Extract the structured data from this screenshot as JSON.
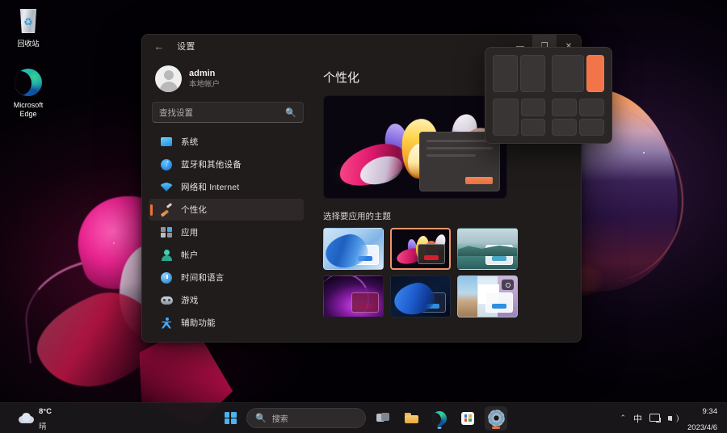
{
  "desktop": {
    "icons": [
      {
        "name": "recycle-bin",
        "label": "回收站"
      },
      {
        "name": "microsoft-edge",
        "label": "Microsoft\nEdge"
      }
    ]
  },
  "window": {
    "title": "设置",
    "back_label": "←",
    "caption": {
      "minimize": "—",
      "maximize": "❐",
      "close": "✕"
    },
    "account": {
      "name": "admin",
      "type": "本地帐户"
    },
    "search": {
      "placeholder": "查找设置",
      "icon": "search-icon"
    },
    "nav": [
      {
        "id": "system",
        "label": "系统",
        "selected": false
      },
      {
        "id": "bluetooth",
        "label": "蓝牙和其他设备",
        "selected": false
      },
      {
        "id": "network",
        "label": "网络和 Internet",
        "selected": false
      },
      {
        "id": "personalization",
        "label": "个性化",
        "selected": true
      },
      {
        "id": "apps",
        "label": "应用",
        "selected": false
      },
      {
        "id": "accounts",
        "label": "帐户",
        "selected": false
      },
      {
        "id": "time-language",
        "label": "时间和语言",
        "selected": false
      },
      {
        "id": "gaming",
        "label": "游戏",
        "selected": false
      },
      {
        "id": "accessibility",
        "label": "辅助功能",
        "selected": false
      }
    ],
    "main": {
      "page_title": "个性化",
      "section_label": "选择要应用的主题",
      "themes": [
        {
          "id": "theme-1",
          "selected": false
        },
        {
          "id": "theme-2",
          "selected": true
        },
        {
          "id": "theme-3",
          "selected": false
        },
        {
          "id": "theme-4",
          "selected": false
        },
        {
          "id": "theme-5",
          "selected": false
        },
        {
          "id": "theme-6",
          "selected": false
        }
      ]
    }
  },
  "snap_layouts": {
    "options": [
      {
        "id": "snap-two-equal",
        "highlight": null
      },
      {
        "id": "snap-left-right",
        "highlight": "right"
      },
      {
        "id": "snap-left-stack",
        "highlight": null
      },
      {
        "id": "snap-quad",
        "highlight": null
      }
    ],
    "accent": "#f2754a"
  },
  "taskbar": {
    "weather": {
      "temperature": "8°C",
      "condition": "晴",
      "icon": "cloud-icon"
    },
    "start": {
      "label": "开始",
      "icon": "windows-flag-icon"
    },
    "search": {
      "placeholder": "搜索",
      "icon": "search-icon"
    },
    "apps": [
      {
        "id": "task-view",
        "icon": "task-view-icon",
        "active": false,
        "indicator": "none"
      },
      {
        "id": "file-explorer",
        "icon": "folder-icon",
        "active": false,
        "indicator": "none"
      },
      {
        "id": "microsoft-edge",
        "icon": "edge-icon",
        "active": false,
        "indicator": "small"
      },
      {
        "id": "microsoft-store",
        "icon": "store-icon",
        "active": false,
        "indicator": "none"
      },
      {
        "id": "settings",
        "icon": "gear-icon",
        "active": true,
        "indicator": "wide"
      }
    ],
    "tray": {
      "chevron": "⌃",
      "ime": "中",
      "network_icon": "network-icon",
      "volume_icon": "volume-icon",
      "time": "9:34",
      "date": "2023/4/6"
    }
  }
}
